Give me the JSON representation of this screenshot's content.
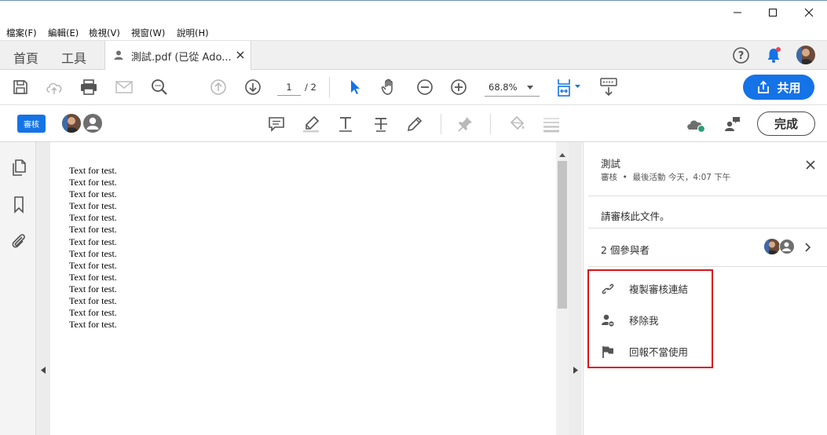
{
  "menu": [
    "檔案(F)",
    "編輯(E)",
    "檢視(V)",
    "視窗(W)",
    "說明(H)"
  ],
  "tabs": {
    "home": "首頁",
    "tools": "工具",
    "doc": "測試.pdf (已從 Ado..."
  },
  "toolbar": {
    "page_current": "1",
    "page_total": "/ 2",
    "zoom": "68.8%",
    "share_label": "共用"
  },
  "review_bar": {
    "badge": "審核",
    "done_label": "完成"
  },
  "document": {
    "lines": [
      "Text for test.",
      "Text for test.",
      "Text for test.",
      "Text for test.",
      "Text for test.",
      "Text for test.",
      "Text for test.",
      "Text for test.",
      "Text for test.",
      "Text for test.",
      "Text for test.",
      "Text for test.",
      "Text for test.",
      "Text for test."
    ]
  },
  "panel": {
    "title": "測試",
    "subtitle": "審核  •  最後活動 今天，4:07 下午",
    "message": "請審核此文件。",
    "participants": "2 個參與者",
    "actions": [
      {
        "label": "複製審核連結",
        "icon": "link-icon"
      },
      {
        "label": "移除我",
        "icon": "remove-user-icon"
      },
      {
        "label": "回報不當使用",
        "icon": "flag-icon"
      }
    ]
  },
  "colors": {
    "accent": "#1473e6",
    "highlight_box": "#d7141a",
    "notify_dot": "#e34850",
    "online": "#2d9d78"
  }
}
